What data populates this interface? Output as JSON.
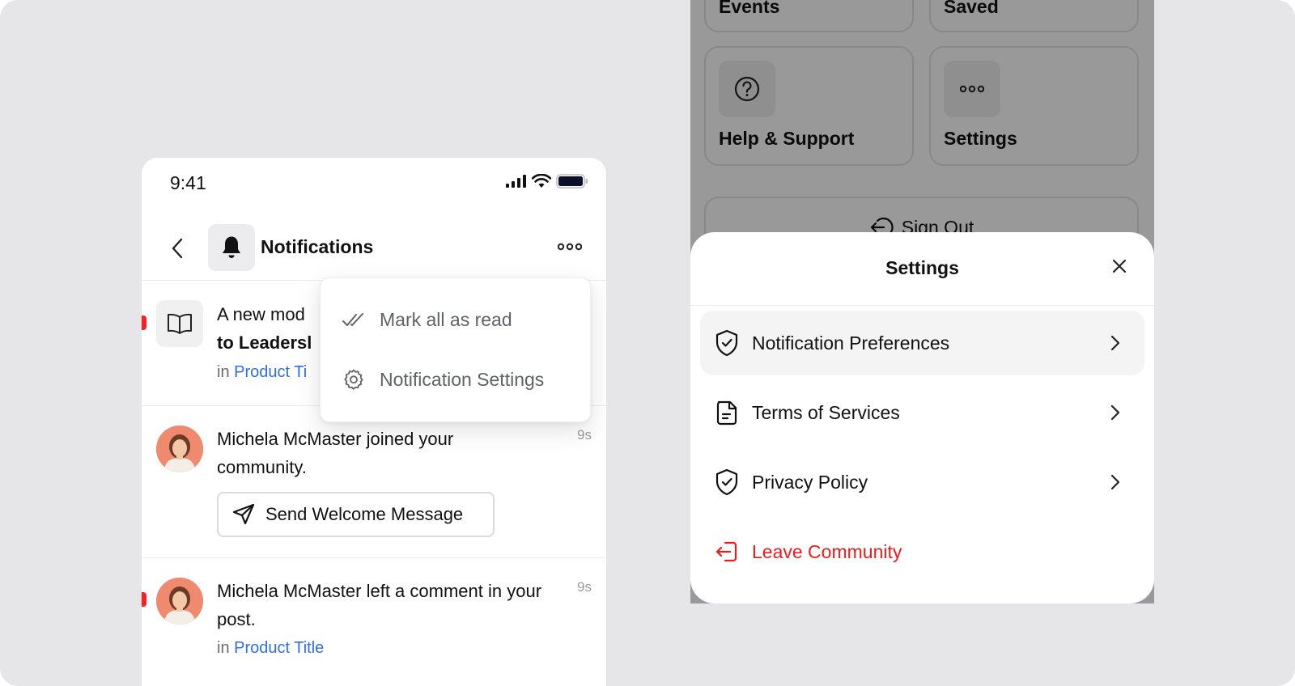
{
  "left": {
    "status_bar": {
      "time": "9:41"
    },
    "header": {
      "title": "Notifications"
    },
    "dropdown": {
      "items": [
        {
          "label": "Mark all as read",
          "icon": "double-check-icon"
        },
        {
          "label": "Notification Settings",
          "icon": "gear-icon"
        }
      ]
    },
    "notifications": [
      {
        "text_prefix": "A new mod",
        "text_bold": "to Leadersl",
        "meta_prefix": "in",
        "meta_link": "Product Ti",
        "unread": true,
        "icon": "book-icon"
      },
      {
        "text": "Michela McMaster joined your community.",
        "ago": "9s",
        "action_label": "Send Welcome Message",
        "unread": false
      },
      {
        "text": "Michela McMaster left a comment in your post.",
        "ago": "9s",
        "meta_prefix": "in",
        "meta_link": "Product Title",
        "unread": true
      }
    ]
  },
  "right": {
    "background_tiles": [
      {
        "label": "Events"
      },
      {
        "label": "Saved"
      },
      {
        "label": "Help & Support",
        "icon": "question-circle-icon"
      },
      {
        "label": "Settings",
        "icon": "more-dots-icon"
      }
    ],
    "sign_out_label": "Sign Out",
    "sheet": {
      "title": "Settings",
      "items": [
        {
          "label": "Notification Preferences",
          "icon": "shield-check-icon",
          "active": true
        },
        {
          "label": "Terms of Services",
          "icon": "document-icon"
        },
        {
          "label": "Privacy Policy",
          "icon": "shield-check-icon"
        },
        {
          "label": "Leave Community",
          "icon": "logout-icon",
          "danger": true
        }
      ]
    }
  },
  "colors": {
    "background": "#e6e6e8",
    "link": "#2f6fe8",
    "unread_dot": "#ff1f1f",
    "danger": "#f01b1b"
  }
}
